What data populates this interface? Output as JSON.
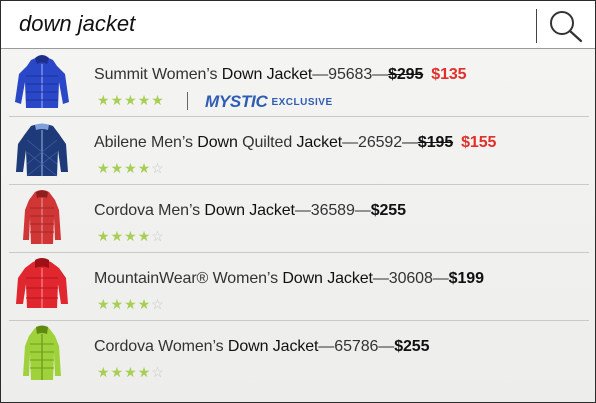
{
  "search": {
    "value": "down jacket"
  },
  "results": [
    {
      "name_a": "Summit Women’s ",
      "name_kw1": "Down",
      "name_b": " ",
      "name_kw2": "Jacket",
      "sku": "—95683—",
      "price_old": "$295",
      "price_new": "$135",
      "rating": 5,
      "badge_brand": "MYSTIC",
      "badge_tag": "EXCLUSIVE",
      "image_color": "#2a47c8"
    },
    {
      "name_a": "Abilene Men’s ",
      "name_kw1": "Down",
      "name_b": " Quilted ",
      "name_kw2": "Jacket",
      "sku": "—26592—",
      "price_old": "$195",
      "price_new": "$155",
      "rating": 4,
      "image_color": "#1f3a78"
    },
    {
      "name_a": "Cordova Men’s ",
      "name_kw1": "Down",
      "name_b": " ",
      "name_kw2": "Jacket",
      "sku": "—36589—",
      "price": "$255",
      "rating": 4,
      "image_color": "#d13636"
    },
    {
      "name_a": "MountainWear® Women’s ",
      "name_kw1": "Down",
      "name_b": " ",
      "name_kw2": "Jacket",
      "sku": "—30608—",
      "price": "$199",
      "rating": 4,
      "image_color": "#e0262e"
    },
    {
      "name_a": "Cordova Women’s ",
      "name_kw1": "Down",
      "name_b": " ",
      "name_kw2": "Jacket",
      "sku": "—65786—",
      "price": "$255",
      "rating": 4,
      "image_color": "#9fd13a"
    }
  ],
  "colors": {
    "sale": "#e0302b",
    "star": "#a7cf55",
    "brand": "#2f5db4"
  }
}
